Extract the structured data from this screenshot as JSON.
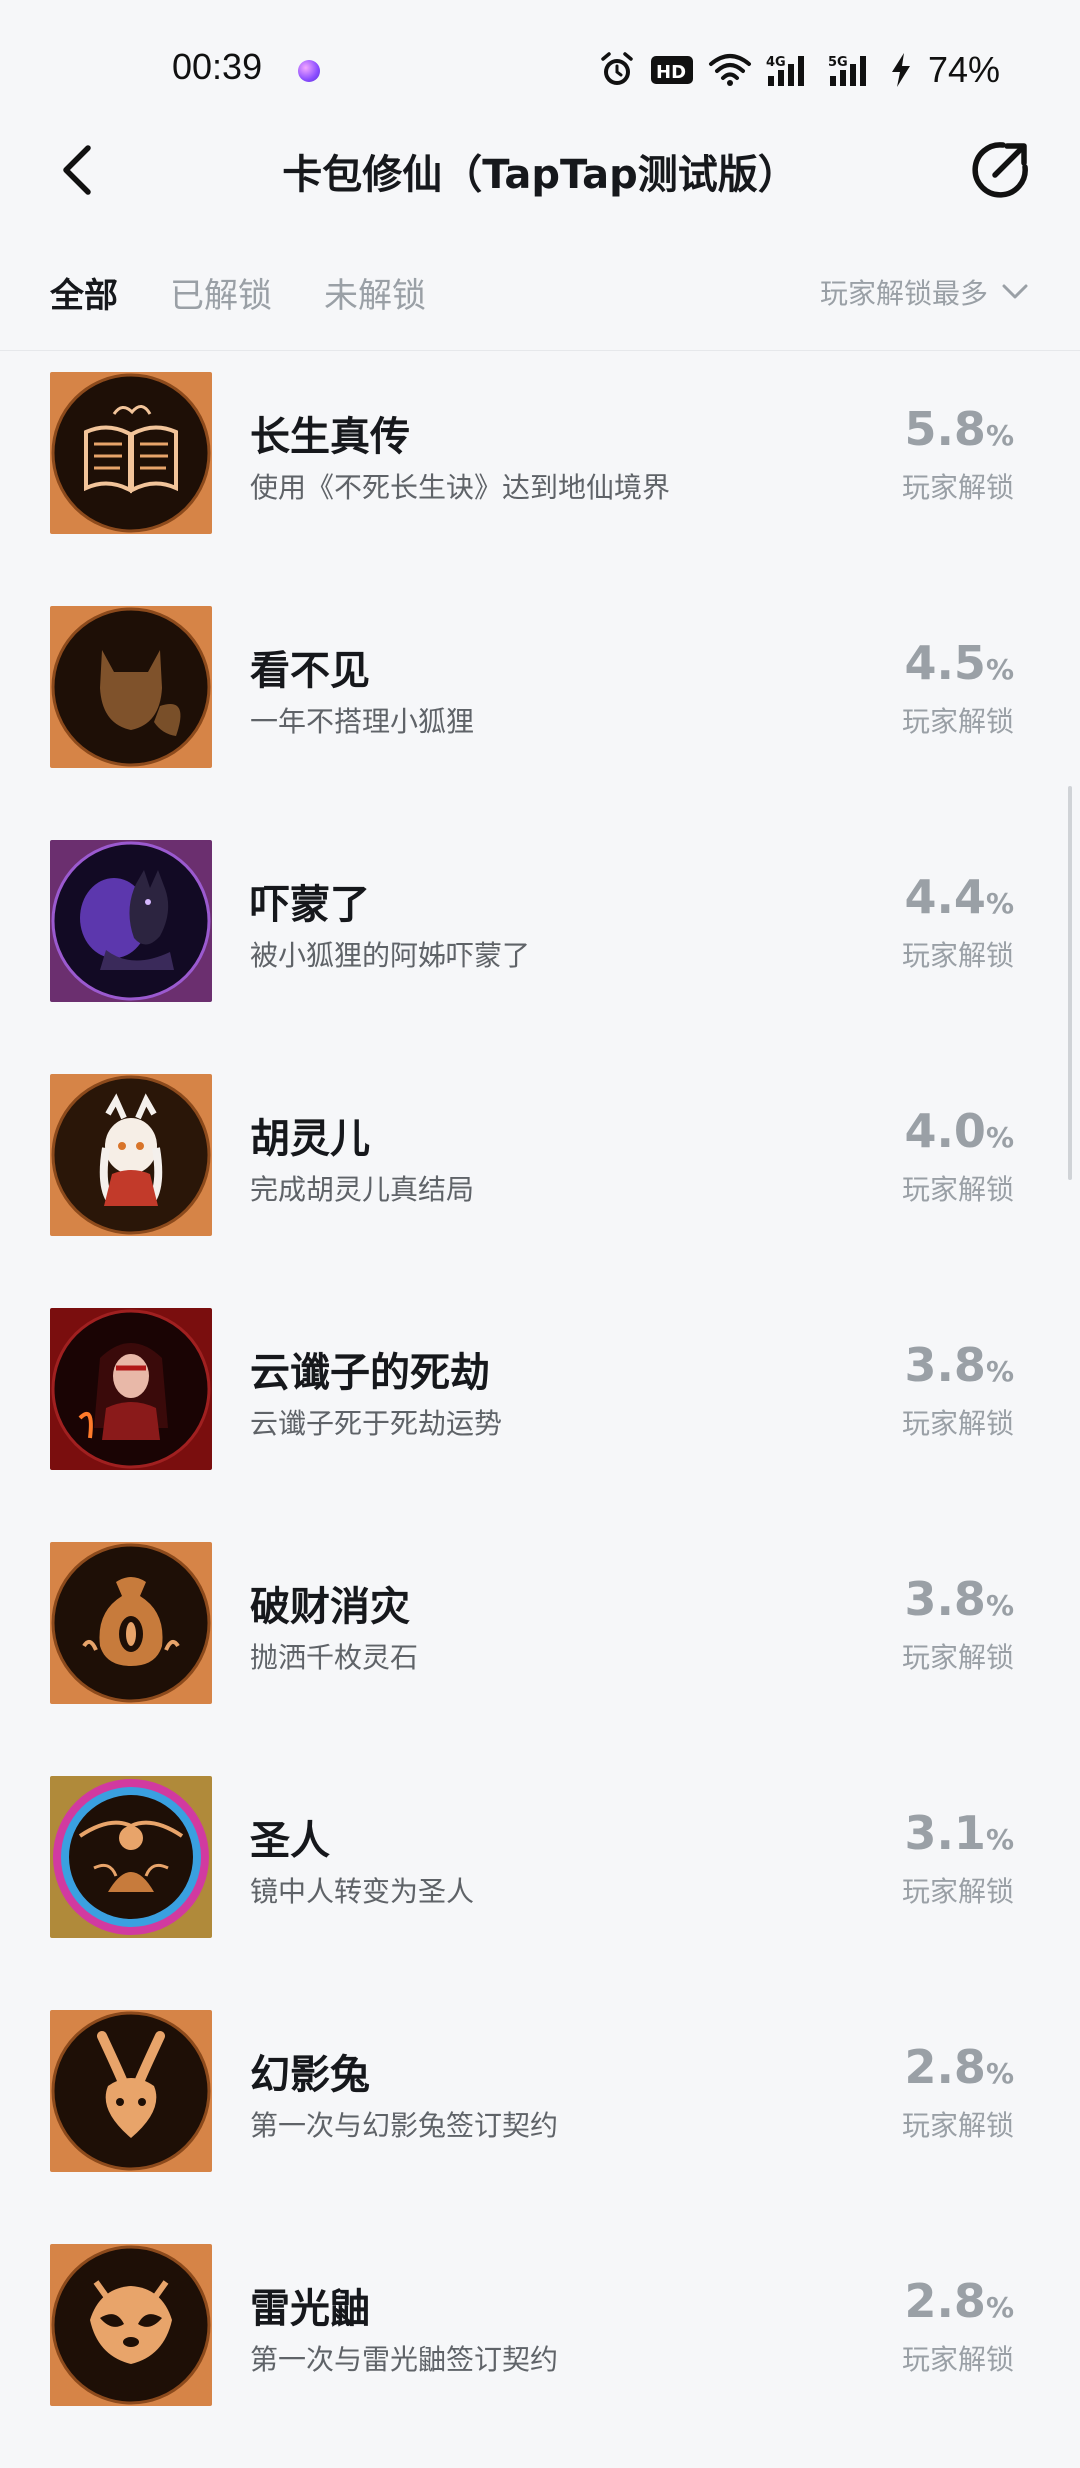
{
  "status_bar": {
    "time": "00:39",
    "battery": "74%",
    "icons": [
      "alarm-icon",
      "hd-icon",
      "wifi-icon",
      "signal-4g-icon",
      "signal-5g-icon",
      "charging-icon"
    ]
  },
  "header": {
    "title": "卡包修仙（TapTap测试版）",
    "back_icon": "chevron-left-icon",
    "share_icon": "share-icon"
  },
  "tabs": [
    {
      "label": "全部",
      "active": true
    },
    {
      "label": "已解锁",
      "active": false
    },
    {
      "label": "未解锁",
      "active": false
    }
  ],
  "sort": {
    "label": "玩家解锁最多",
    "icon": "chevron-down-icon"
  },
  "colors": {
    "background": "#f6f7f9",
    "text_primary": "#16181c",
    "text_secondary": "#5f6368",
    "text_muted": "#9aa0a6",
    "badge_gold": "#e8a46a",
    "badge_dark": "#2a1608",
    "badge_purple": "#6b2f8f",
    "badge_red": "#7a0e0e"
  },
  "achievements": [
    {
      "title": "长生真传",
      "desc": "使用《不死长生诀》达到地仙境界",
      "pct": "5.8",
      "pct_sign": "%",
      "pct_label": "玩家解锁",
      "icon": "book-icon"
    },
    {
      "title": "看不见",
      "desc": "一年不搭理小狐狸",
      "pct": "4.5",
      "pct_sign": "%",
      "pct_label": "玩家解锁",
      "icon": "fox-silhouette-icon"
    },
    {
      "title": "吓蒙了",
      "desc": "被小狐狸的阿姊吓蒙了",
      "pct": "4.4",
      "pct_sign": "%",
      "pct_label": "玩家解锁",
      "icon": "fox-sister-icon"
    },
    {
      "title": "胡灵儿",
      "desc": "完成胡灵儿真结局",
      "pct": "4.0",
      "pct_sign": "%",
      "pct_label": "玩家解锁",
      "icon": "fox-girl-icon"
    },
    {
      "title": "云谶子的死劫",
      "desc": "云谶子死于死劫运势",
      "pct": "3.8",
      "pct_sign": "%",
      "pct_label": "玩家解锁",
      "icon": "cursed-figure-icon"
    },
    {
      "title": "破财消灾",
      "desc": "抛洒千枚灵石",
      "pct": "3.8",
      "pct_sign": "%",
      "pct_label": "玩家解锁",
      "icon": "money-bag-icon"
    },
    {
      "title": "圣人",
      "desc": "镜中人转变为圣人",
      "pct": "3.1",
      "pct_sign": "%",
      "pct_label": "玩家解锁",
      "icon": "sage-icon"
    },
    {
      "title": "幻影兔",
      "desc": "第一次与幻影兔签订契约",
      "pct": "2.8",
      "pct_sign": "%",
      "pct_label": "玩家解锁",
      "icon": "rabbit-icon"
    },
    {
      "title": "雷光鼬",
      "desc": "第一次与雷光鼬签订契约",
      "pct": "2.8",
      "pct_sign": "%",
      "pct_label": "玩家解锁",
      "icon": "weasel-icon"
    }
  ]
}
